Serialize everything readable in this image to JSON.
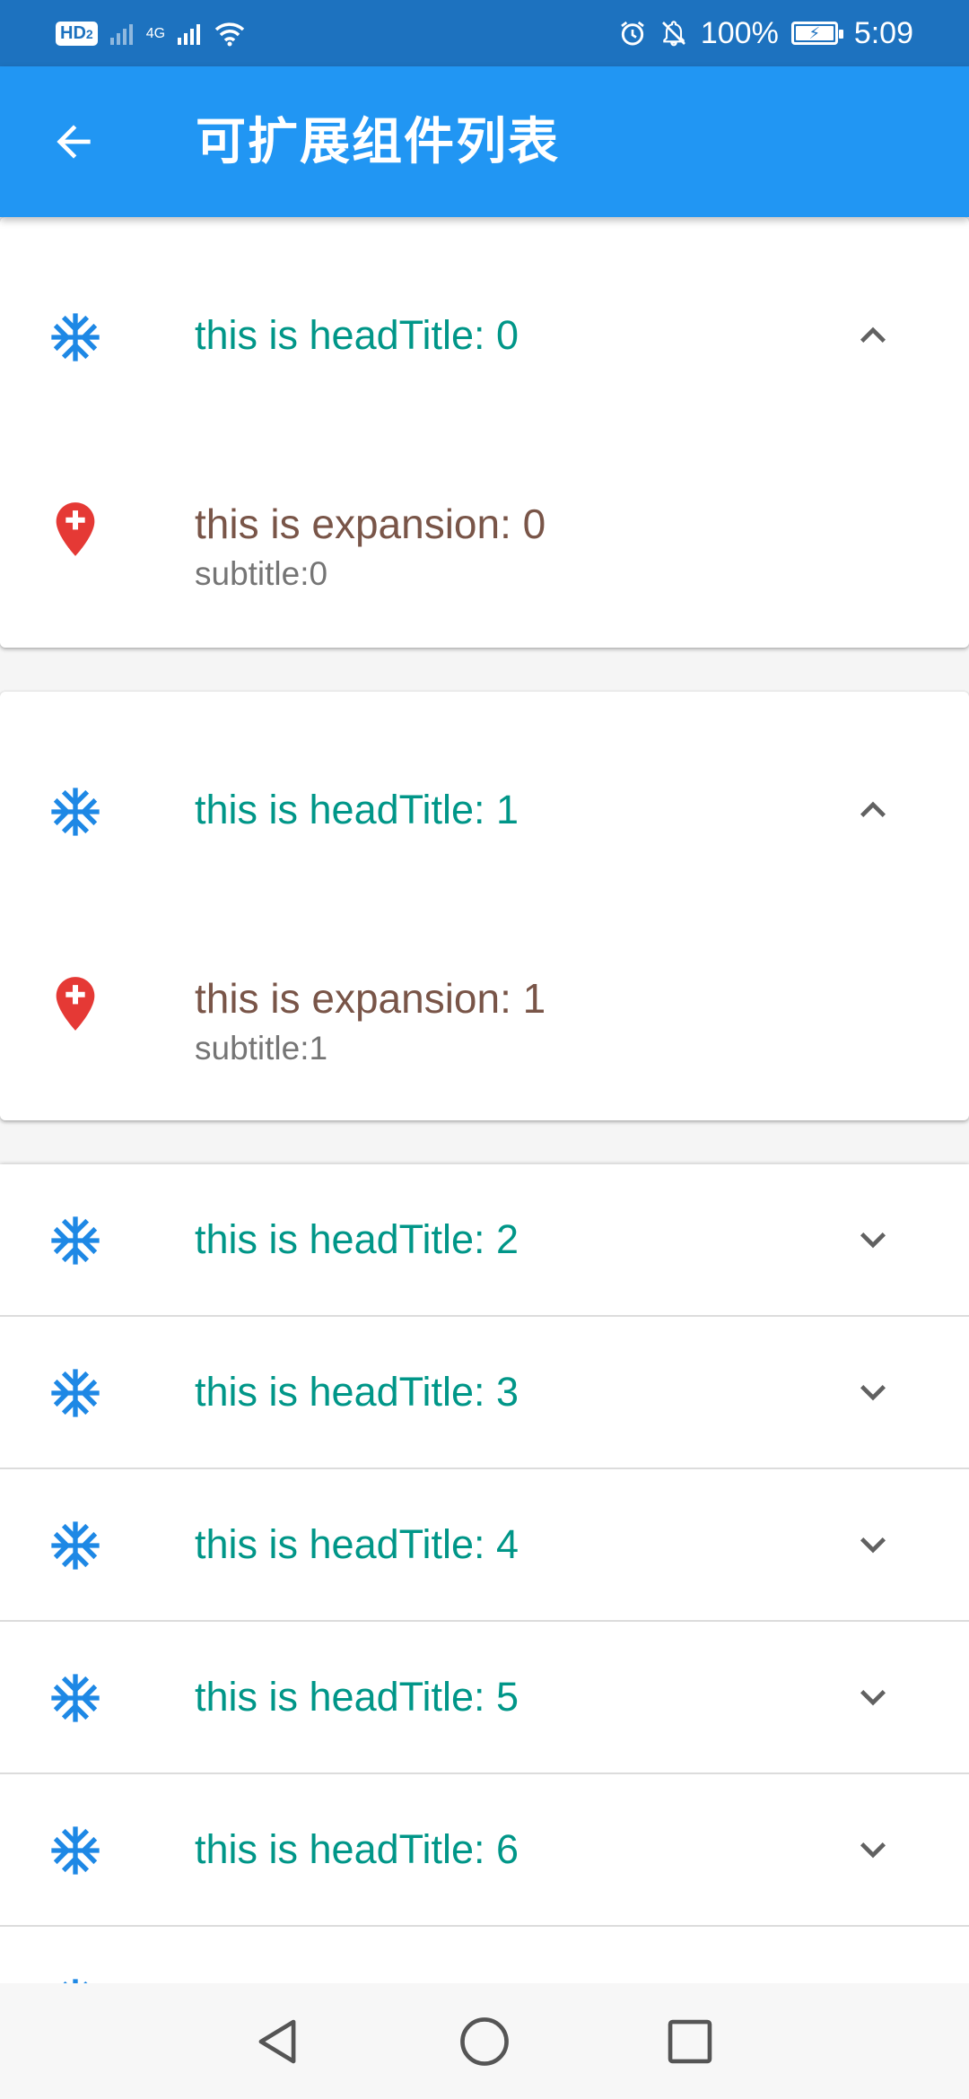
{
  "status_bar": {
    "hd": "HD",
    "hd_sub": "2",
    "network": "4G",
    "battery": "100%",
    "time": "5:09"
  },
  "app_bar": {
    "title": "可扩展组件列表",
    "back_icon": "arrow-back-icon"
  },
  "colors": {
    "status_bar": "#1d72bf",
    "app_bar": "#2196f3",
    "head_title": "#009688",
    "expansion_title": "#795548",
    "subtitle": "#757575",
    "leading_icon": "#1e88e5",
    "pin_icon": "#e53935"
  },
  "icons": {
    "leading": "snowflake-icon",
    "expansion": "add-location-icon",
    "expanded_chevron": "expand-less-icon",
    "collapsed_chevron": "expand-more-icon"
  },
  "panels": [
    {
      "head_title": "this is headTitle: 0",
      "expanded": true,
      "expansion_title": "this is expansion: 0",
      "expansion_subtitle": "subtitle:0"
    },
    {
      "head_title": "this is headTitle: 1",
      "expanded": true,
      "expansion_title": "this is expansion: 1",
      "expansion_subtitle": "subtitle:1"
    },
    {
      "head_title": "this is headTitle: 2",
      "expanded": false
    },
    {
      "head_title": "this is headTitle: 3",
      "expanded": false
    },
    {
      "head_title": "this is headTitle: 4",
      "expanded": false
    },
    {
      "head_title": "this is headTitle: 5",
      "expanded": false
    },
    {
      "head_title": "this is headTitle: 6",
      "expanded": false
    }
  ],
  "nav_bar": {
    "back": "nav-back-icon",
    "home": "nav-home-icon",
    "recents": "nav-recents-icon"
  }
}
